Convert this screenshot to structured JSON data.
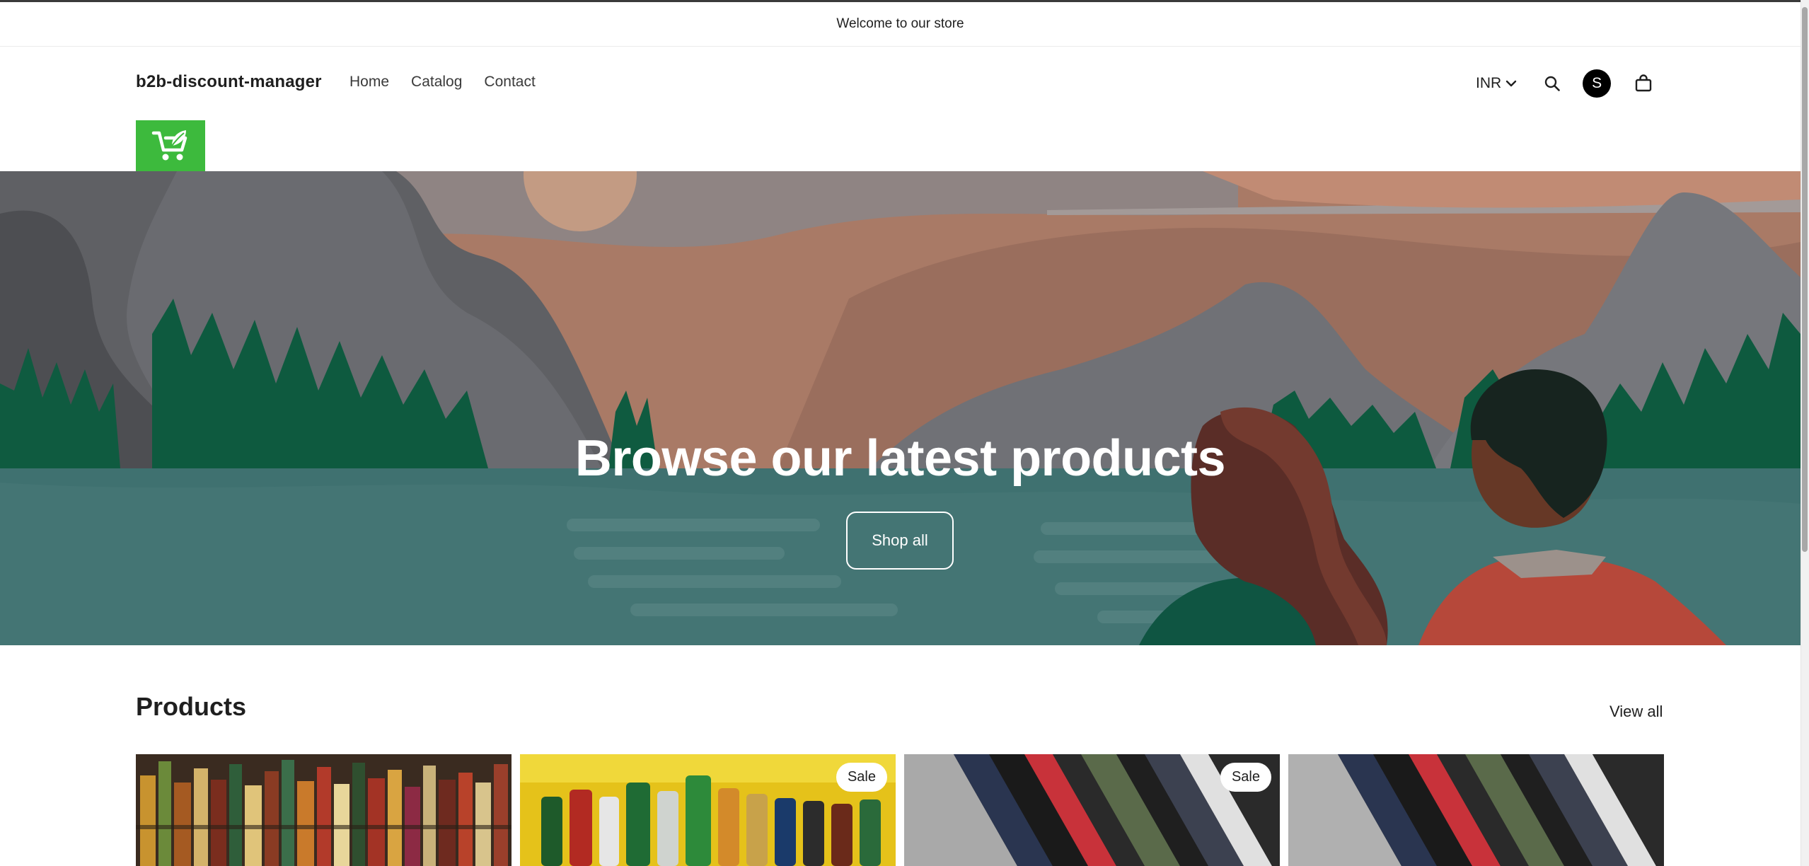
{
  "announcement": {
    "text": "Welcome to our store"
  },
  "header": {
    "brand": "b2b-discount-manager",
    "nav": [
      {
        "label": "Home"
      },
      {
        "label": "Catalog"
      },
      {
        "label": "Contact"
      }
    ],
    "currency": "INR",
    "account_initial": "S",
    "icons": [
      "chevron-down-icon",
      "search-icon",
      "cart-bag-icon",
      "shopping-cart-logo-icon"
    ],
    "logo_color": "#3dba3d"
  },
  "hero": {
    "title": "Browse our latest products",
    "button_label": "Shop all"
  },
  "products": {
    "title": "Products",
    "view_all": "View all",
    "cards": [
      {
        "badge": ""
      },
      {
        "badge": "Sale"
      },
      {
        "badge": "Sale"
      },
      {
        "badge": ""
      }
    ]
  }
}
